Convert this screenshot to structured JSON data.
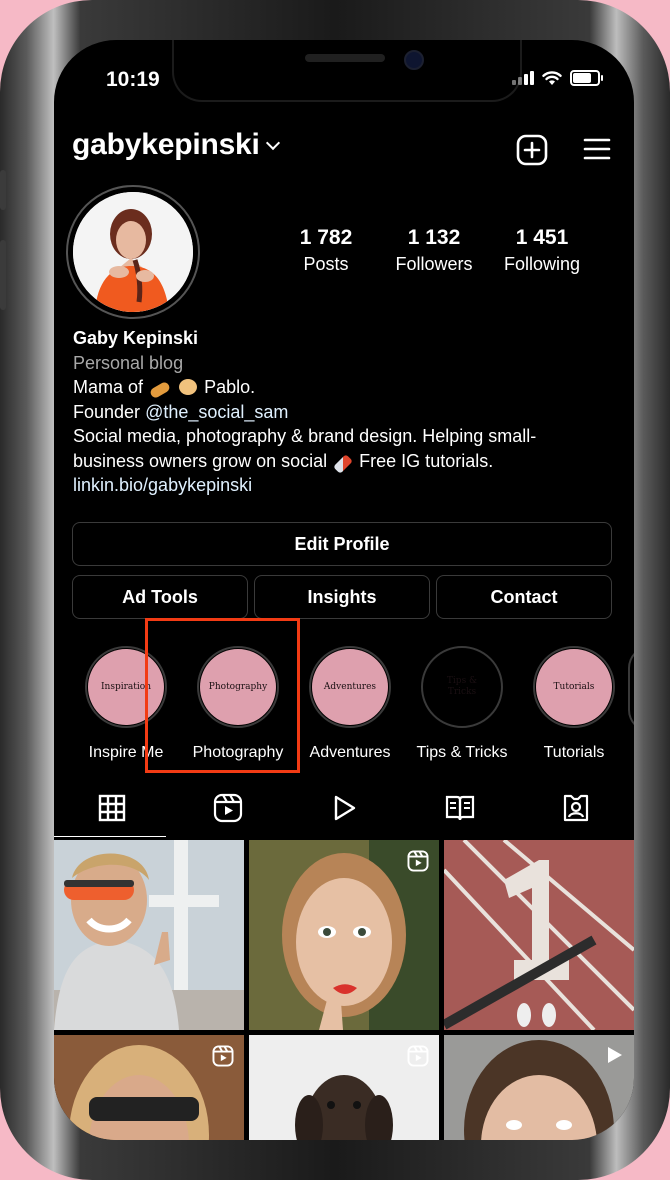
{
  "colors": {
    "background": "#f6b9c6",
    "screen": "#000000",
    "highlight_fill": "#dea0ae",
    "selection": "#f23b14",
    "link": "#e0f1ff",
    "muted": "#a8a8a8"
  },
  "status_bar": {
    "time": "10:19",
    "icons": [
      "signal-icon",
      "wifi-icon",
      "battery-icon"
    ]
  },
  "header": {
    "username": "gabykepinski",
    "icons": [
      "chevron-down-icon",
      "new-post-icon",
      "menu-icon"
    ]
  },
  "stats": [
    {
      "value": "1 782",
      "label": "Posts"
    },
    {
      "value": "1 132",
      "label": "Followers"
    },
    {
      "value": "1 451",
      "label": "Following"
    }
  ],
  "bio": {
    "name": "Gaby Kepinski",
    "category": "Personal blog",
    "line1_prefix": "Mama of",
    "line1_suffix": "Pablo.",
    "line2_prefix": "Founder",
    "line2_mention": "@the_social_sam",
    "line3": "Social media, photography & brand design. Helping small-",
    "line4_prefix": "business owners grow on social",
    "line4_suffix": "Free IG tutorials.",
    "link": "linkin.bio/gabykepinski"
  },
  "buttons": {
    "edit_profile": "Edit Profile",
    "ad_tools": "Ad Tools",
    "insights": "Insights",
    "contact": "Contact"
  },
  "highlights": [
    {
      "cover_text": "Inspiration",
      "label": "Inspire Me"
    },
    {
      "cover_text": "Photography",
      "label": "Photography",
      "selected": true
    },
    {
      "cover_text": "Adventures",
      "label": "Adventures"
    },
    {
      "cover_text": "Tips & Tricks",
      "label": "Tips & Tricks"
    },
    {
      "cover_text": "Tutorials",
      "label": "Tutorials"
    }
  ],
  "tabs": [
    "grid-icon",
    "reels-icon",
    "play-icon",
    "guides-icon",
    "tagged-icon"
  ],
  "active_tab": "grid-icon"
}
